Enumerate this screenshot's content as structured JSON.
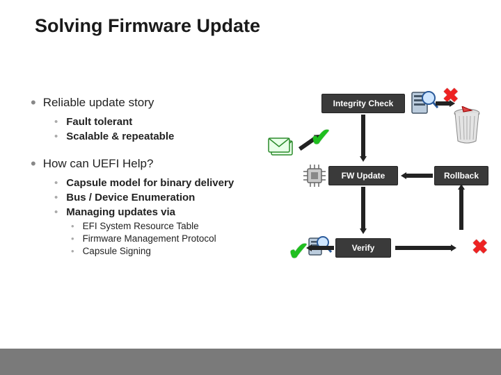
{
  "title": "Solving Firmware Update",
  "bullets": {
    "b1": "Reliable update story",
    "b1a": "Fault tolerant",
    "b1b": "Scalable & repeatable",
    "b2": "How can UEFI Help?",
    "b2a": "Capsule model for binary delivery",
    "b2b": "Bus / Device Enumeration",
    "b2c": "Managing updates via",
    "b2c1": "EFI System Resource Table",
    "b2c2": "Firmware Management Protocol",
    "b2c3": "Capsule Signing"
  },
  "diagram": {
    "integrity": "Integrity Check",
    "fwupdate": "FW Update",
    "verify": "Verify",
    "rollback": "Rollback"
  }
}
